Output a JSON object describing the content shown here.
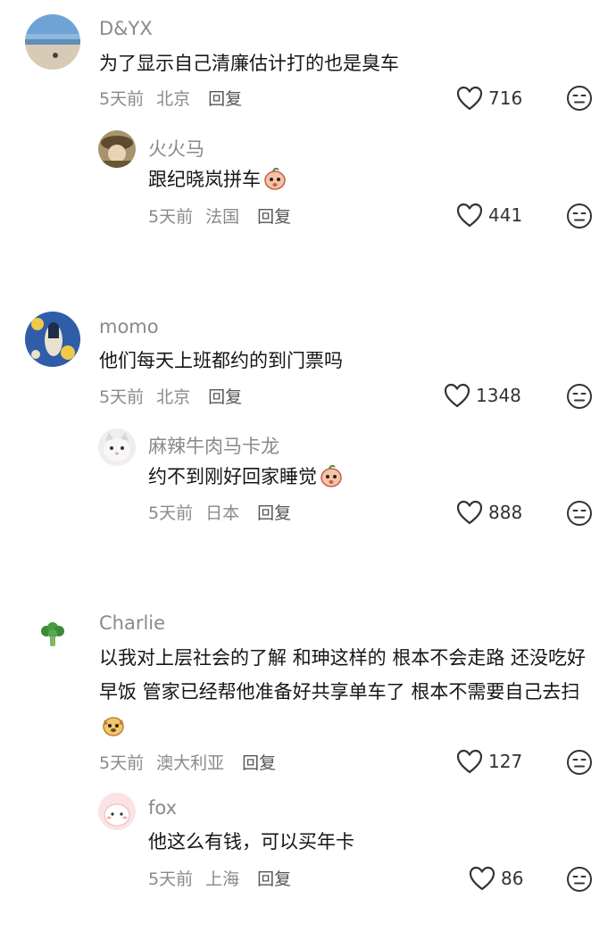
{
  "comments": [
    {
      "user": "D&YX",
      "text": "为了显示自己清廉估计打的也是臭车",
      "time": "5天前",
      "location": "北京",
      "reply_label": "回复",
      "likes": "716",
      "replies": [
        {
          "user": "火火马",
          "text": "跟纪晓岚拼车",
          "time": "5天前",
          "location": "法国",
          "reply_label": "回复",
          "likes": "441"
        }
      ]
    },
    {
      "user": "momo",
      "text": "他们每天上班都约的到门票吗",
      "time": "5天前",
      "location": "北京",
      "reply_label": "回复",
      "likes": "1348",
      "replies": [
        {
          "user": "麻辣牛肉马卡龙",
          "text": "约不到刚好回家睡觉",
          "time": "5天前",
          "location": "日本",
          "reply_label": "回复",
          "likes": "888"
        }
      ]
    },
    {
      "user": "Charlie",
      "text": "以我对上层社会的了解 和珅这样的 根本不会走路 还没吃好早饭 管家已经帮他准备好共享单车了 根本不需要自己去扫",
      "time": "5天前",
      "location": "澳大利亚",
      "reply_label": "回复",
      "likes": "127",
      "replies": [
        {
          "user": "fox",
          "text": "他这么有钱，可以买年卡",
          "time": "5天前",
          "location": "上海",
          "reply_label": "回复",
          "likes": "86"
        }
      ]
    }
  ],
  "icons": {
    "like": "heart-outline-icon",
    "dislike": "expressionless-face-icon"
  },
  "colors": {
    "text": "#161616",
    "muted": "#8a8a8a",
    "icon": "#333333"
  }
}
